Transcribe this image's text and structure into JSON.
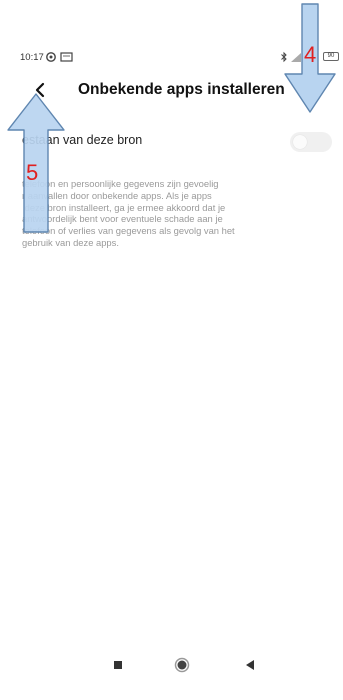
{
  "status_bar": {
    "time": "10:17",
    "icons": [
      "settings-status-icon",
      "screenshot-status-icon",
      "bluetooth-icon",
      "signal-icon",
      "battery-icon"
    ],
    "battery_label": "90"
  },
  "header": {
    "back_icon": "chevron-left-icon",
    "title": "Onbekende apps installeren"
  },
  "setting": {
    "label": "estaan van deze bron",
    "toggle_on": false
  },
  "warning": {
    "lines": [
      "telefoon en persoonlijke gegevens zijn gevoelig",
      "r aanvallen door onbekende apps. Als je apps",
      " deze bron installeert, ga je ermee akkoord dat je",
      "antwoordelijk bent voor eventuele schade aan je",
      "telefoon of verlies van gegevens als gevolg van het",
      "gebruik van deze apps."
    ]
  },
  "nav_bar": {
    "items": [
      "recents-square-icon",
      "home-circle-icon",
      "back-triangle-icon"
    ]
  },
  "annotations": [
    {
      "number": "4",
      "arrow": "down-arrow-icon"
    },
    {
      "number": "5",
      "arrow": "up-arrow-icon"
    }
  ],
  "colors": {
    "background": "#ffffff",
    "annotation_arrow": "#b8d4f0",
    "annotation_number": "#e02020",
    "toggle_off": "#f0f0f0",
    "warning_text": "#9a9a9a"
  }
}
